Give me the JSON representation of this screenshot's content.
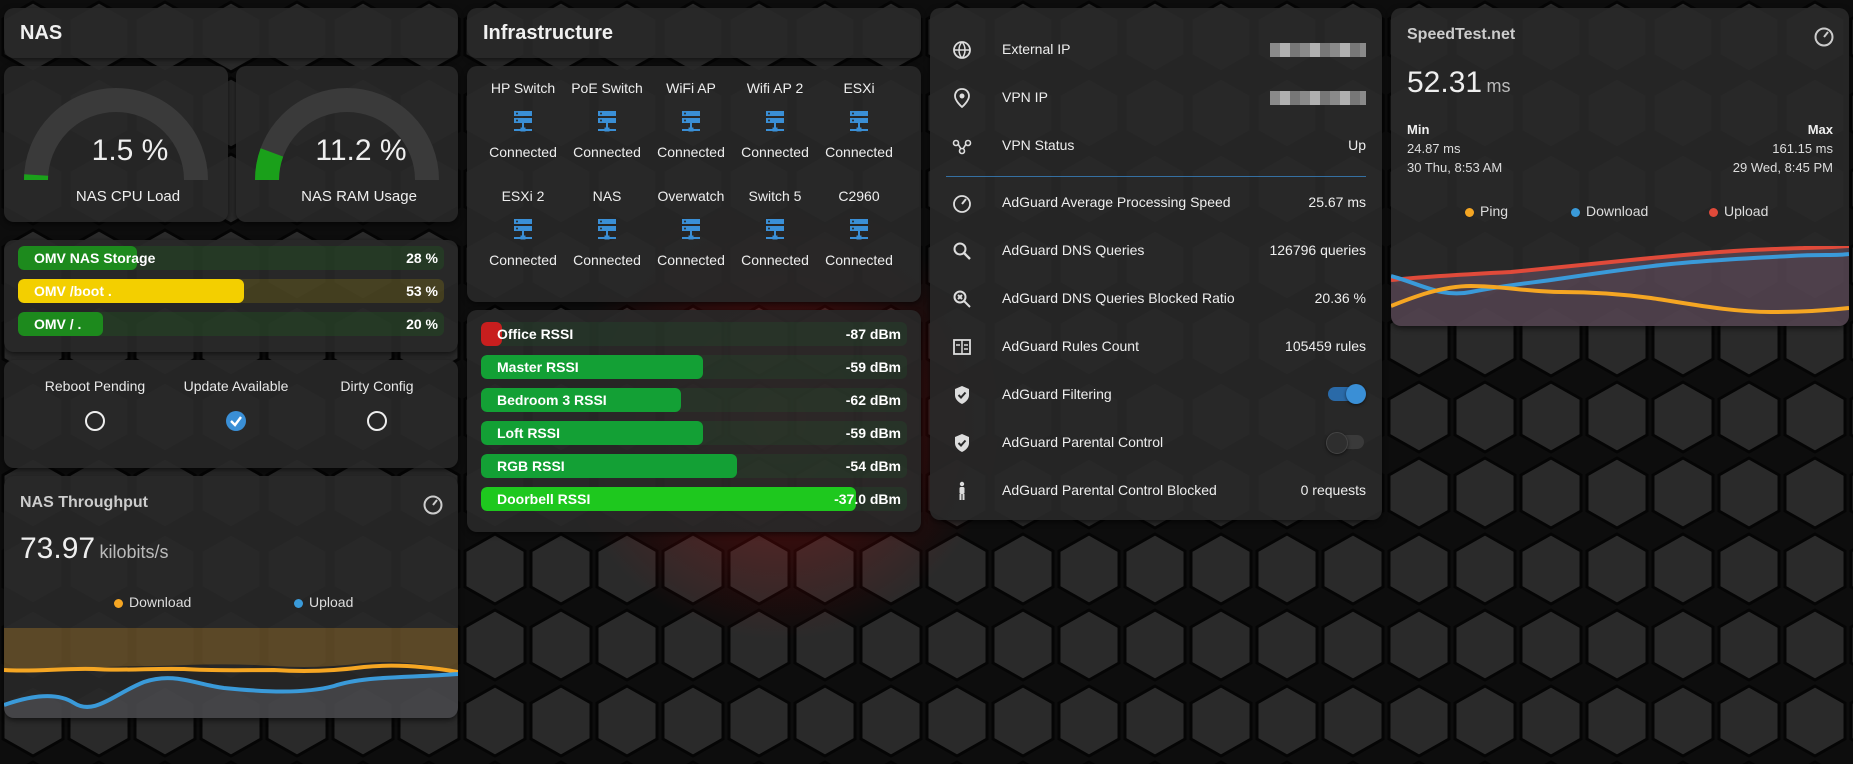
{
  "nas": {
    "title": "NAS",
    "cpu": {
      "value": "1.5 %",
      "label": "NAS CPU Load",
      "fraction": 0.015
    },
    "ram": {
      "value": "11.2 %",
      "label": "NAS RAM Usage",
      "fraction": 0.112
    },
    "storage": [
      {
        "label": "OMV NAS Storage",
        "value": "28 %",
        "percent": 28,
        "color": "#1d8a1d"
      },
      {
        "label": "OMV /boot .",
        "value": "53 %",
        "percent": 53,
        "color": "#f3cf00"
      },
      {
        "label": "OMV / .",
        "value": "20 %",
        "percent": 20,
        "color": "#1d8a1d"
      }
    ],
    "status": [
      {
        "label": "Reboot Pending",
        "checked": false
      },
      {
        "label": "Update Available",
        "checked": true
      },
      {
        "label": "Dirty Config",
        "checked": false
      }
    ]
  },
  "throughput": {
    "title": "NAS Throughput",
    "value": "73.97",
    "unit": "kilobits/s",
    "legend": [
      {
        "name": "Download",
        "color": "#f5a623"
      },
      {
        "name": "Upload",
        "color": "#3a9ad9"
      }
    ]
  },
  "infra": {
    "title": "Infrastructure",
    "devices": [
      {
        "name": "HP Switch",
        "status": "Connected"
      },
      {
        "name": "PoE Switch",
        "status": "Connected"
      },
      {
        "name": "WiFi AP",
        "status": "Connected"
      },
      {
        "name": "Wifi AP 2",
        "status": "Connected"
      },
      {
        "name": "ESXi",
        "status": "Connected"
      },
      {
        "name": "ESXi 2",
        "status": "Connected"
      },
      {
        "name": "NAS",
        "status": "Connected"
      },
      {
        "name": "Overwatch",
        "status": "Connected"
      },
      {
        "name": "Switch 5",
        "status": "Connected"
      },
      {
        "name": "C2960",
        "status": "Connected"
      }
    ]
  },
  "rssi": [
    {
      "label": "Office RSSI",
      "value": "-87 dBm",
      "level": 0.05,
      "color": "#c81e1e"
    },
    {
      "label": "Master RSSI",
      "value": "-59 dBm",
      "level": 0.52,
      "color": "#13a035"
    },
    {
      "label": "Bedroom 3 RSSI",
      "value": "-62 dBm",
      "level": 0.47,
      "color": "#13a035"
    },
    {
      "label": "Loft RSSI",
      "value": "-59 dBm",
      "level": 0.52,
      "color": "#13a035"
    },
    {
      "label": "RGB RSSI",
      "value": "-54 dBm",
      "level": 0.6,
      "color": "#13a035"
    },
    {
      "label": "Doorbell RSSI",
      "value": "-37.0 dBm",
      "level": 0.88,
      "color": "#1ec81e"
    }
  ],
  "network": {
    "external_ip": {
      "label": "External IP"
    },
    "vpn_ip": {
      "label": "VPN IP"
    },
    "vpn_status": {
      "label": "VPN Status",
      "value": "Up"
    },
    "adguard": [
      {
        "icon": "speedometer-icon",
        "label": "AdGuard Average Processing Speed",
        "value": "25.67 ms"
      },
      {
        "icon": "magnify-icon",
        "label": "AdGuard DNS Queries",
        "value": "126796 queries"
      },
      {
        "icon": "magnify-close-icon",
        "label": "AdGuard DNS Queries Blocked Ratio",
        "value": "20.36 %"
      },
      {
        "icon": "rules-icon",
        "label": "AdGuard Rules Count",
        "value": "105459 rules"
      },
      {
        "icon": "shield-check-icon",
        "label": "AdGuard Filtering",
        "toggle": true
      },
      {
        "icon": "shield-check-icon",
        "label": "AdGuard Parental Control",
        "toggle": false
      },
      {
        "icon": "human-child-icon",
        "label": "AdGuard Parental Control Blocked",
        "value": "0 requests"
      }
    ]
  },
  "speedtest": {
    "title": "SpeedTest.net",
    "value": "52.31",
    "unit": "ms",
    "min_label": "Min",
    "min_value": "24.87 ms",
    "min_time": "30 Thu, 8:53 AM",
    "max_label": "Max",
    "max_value": "161.15 ms",
    "max_time": "29 Wed, 8:45 PM",
    "legend": [
      {
        "name": "Ping",
        "color": "#f5a623"
      },
      {
        "name": "Download",
        "color": "#3a9ad9"
      },
      {
        "name": "Upload",
        "color": "#e04a3a"
      }
    ]
  },
  "colors": {
    "accent": "#3a8fd6",
    "card": "#282828",
    "green": "#1d8a1d"
  }
}
